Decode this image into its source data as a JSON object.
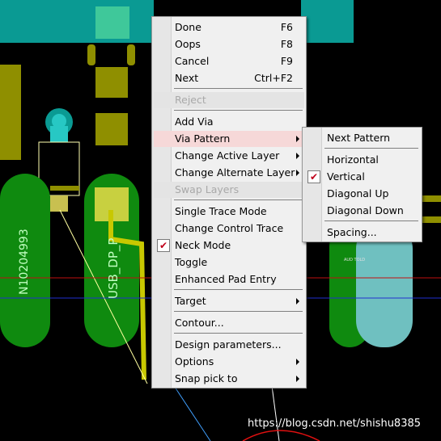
{
  "board": {
    "net_label_1": "N10204993",
    "net_label_2": "USB_DP_P",
    "small_label": "AUD TOLD"
  },
  "context_menu": {
    "items": [
      {
        "label": "Done",
        "shortcut": "F6"
      },
      {
        "label": "Oops",
        "shortcut": "F8"
      },
      {
        "label": "Cancel",
        "shortcut": "F9"
      },
      {
        "label": "Next",
        "shortcut": "Ctrl+F2"
      },
      {
        "label": "Reject",
        "disabled": true
      },
      {
        "label": "Add Via"
      },
      {
        "label": "Via Pattern",
        "submenu": true,
        "highlighted": true
      },
      {
        "label": "Change Active Layer",
        "submenu": true
      },
      {
        "label": "Change Alternate Layer",
        "submenu": true
      },
      {
        "label": "Swap Layers",
        "disabled": true
      },
      {
        "label": "Single Trace Mode"
      },
      {
        "label": "Change Control Trace"
      },
      {
        "label": "Neck Mode",
        "checked": true
      },
      {
        "label": "Toggle"
      },
      {
        "label": "Enhanced Pad Entry"
      },
      {
        "label": "Target",
        "submenu": true
      },
      {
        "label": "Contour..."
      },
      {
        "label": "Design parameters..."
      },
      {
        "label": "Options",
        "submenu": true
      },
      {
        "label": "Snap pick to",
        "submenu": true
      }
    ]
  },
  "via_pattern_submenu": {
    "items": [
      {
        "label": "Next Pattern"
      },
      {
        "label": "Horizontal"
      },
      {
        "label": "Vertical",
        "checked": true
      },
      {
        "label": "Diagonal Up"
      },
      {
        "label": "Diagonal Down"
      },
      {
        "label": "Spacing..."
      }
    ]
  },
  "check_glyph": "✔",
  "watermark": "https://blog.csdn.net/shishu8385",
  "colors": {
    "background": "#000000",
    "pad_green": "#0f8a0f",
    "teal": "#0a9a93",
    "olive": "#8f8f00",
    "cyan": "#27c8c4",
    "highlight": "#f6d8d8"
  }
}
